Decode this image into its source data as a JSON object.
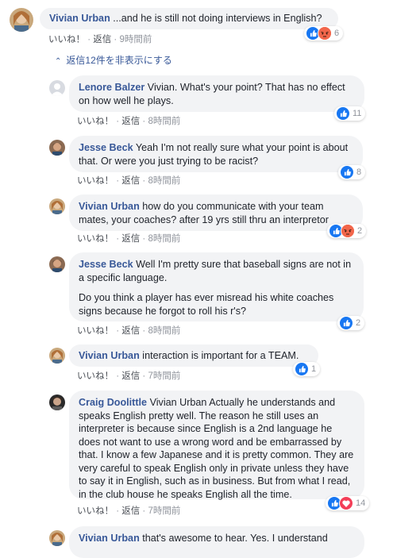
{
  "actions": {
    "like": "いいね！",
    "reply": "返信",
    "sep": " · "
  },
  "hide_replies_label": "返信12件を非表示にする",
  "colors": {
    "author": "#385898",
    "like": "#1877f2",
    "angry": "#f2664b",
    "love": "#f33e58",
    "bubble": "#f2f3f5"
  },
  "comments": [
    {
      "author": "Vivian Urban",
      "text": [
        "...and he is still not doing interviews in English?"
      ],
      "time": "9時間前",
      "reactions": [
        "like-icon",
        "angry-icon"
      ],
      "count": "6",
      "avatar": "vivian"
    },
    {
      "author": "Lenore Balzer",
      "text": [
        "Vivian. What's your point? That has no effect on how well he plays."
      ],
      "time": "8時間前",
      "reactions": [
        "like-icon"
      ],
      "count": "11",
      "avatar": "default"
    },
    {
      "author": "Jesse Beck",
      "text": [
        "Yeah I'm not really sure what your point is about that. Or were you just trying to be racist?"
      ],
      "time": "8時間前",
      "reactions": [
        "like-icon"
      ],
      "count": "8",
      "avatar": "jesse"
    },
    {
      "author": "Vivian Urban",
      "text": [
        "how do you communicate with your team mates, your coaches? after 19 yrs still thru an interpretor"
      ],
      "time": "8時間前",
      "reactions": [
        "like-icon",
        "angry-icon"
      ],
      "count": "2",
      "avatar": "vivian"
    },
    {
      "author": "Jesse Beck",
      "text": [
        "Well I'm pretty sure that baseball signs are not in a specific language.",
        "Do you think a player has ever misread his white coaches signs because he forgot to roll his r's?"
      ],
      "time": "8時間前",
      "reactions": [
        "like-icon"
      ],
      "count": "2",
      "avatar": "jesse"
    },
    {
      "author": "Vivian Urban",
      "text": [
        "interaction is important for a TEAM."
      ],
      "time": "7時間前",
      "reactions": [
        "like-icon"
      ],
      "count": "1",
      "avatar": "vivian"
    },
    {
      "author": "Craig Doolittle",
      "text": [
        "Vivian Urban Actually he understands and speaks English pretty well. The reason he still uses an interpreter is because since English is a 2nd language he does not want to use a wrong word and be embarrassed by that. I know a few Japanese and it is pretty common. They are very careful to speak English only in private unless they have to say it in English, such as in business. But from what I read, in the club house he speaks English all the time."
      ],
      "time": "7時間前",
      "reactions": [
        "like-icon",
        "love-icon"
      ],
      "count": "14",
      "avatar": "craig"
    },
    {
      "author": "Vivian Urban",
      "text": [
        "that's awesome to hear. Yes. I understand"
      ],
      "time": "",
      "reactions": [],
      "count": "",
      "avatar": "vivian"
    }
  ]
}
